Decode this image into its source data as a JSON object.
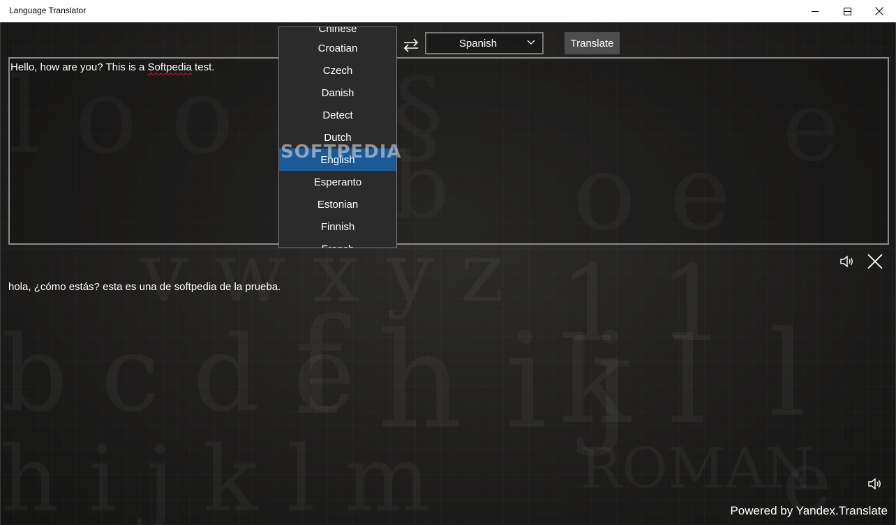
{
  "window": {
    "title": "Language Translator"
  },
  "toolbar": {
    "target_language": "Spanish",
    "translate_label": "Translate"
  },
  "source_dropdown": {
    "items": [
      "Chinese",
      "Croatian",
      "Czech",
      "Danish",
      "Detect",
      "Dutch",
      "English",
      "Esperanto",
      "Estonian",
      "Finnish",
      "French"
    ],
    "selected": "English"
  },
  "input": {
    "text_before": "Hello, how are you? This is a ",
    "text_misspelled": "Softpedia",
    "text_after": " test."
  },
  "output": {
    "text": "hola, ¿cómo estás? esta es una de softpedia de la prueba."
  },
  "footer": {
    "powered_by": "Powered by Yandex.Translate"
  },
  "watermark": "SOFTPEDIA",
  "icons": {
    "swap": "swap-arrows-icon",
    "speaker": "speaker-icon",
    "clear": "close-icon",
    "dropdown_chevron": "chevron-down-icon"
  },
  "colors": {
    "selection": "#1b5a98",
    "spelling_underline": "#e81123"
  }
}
